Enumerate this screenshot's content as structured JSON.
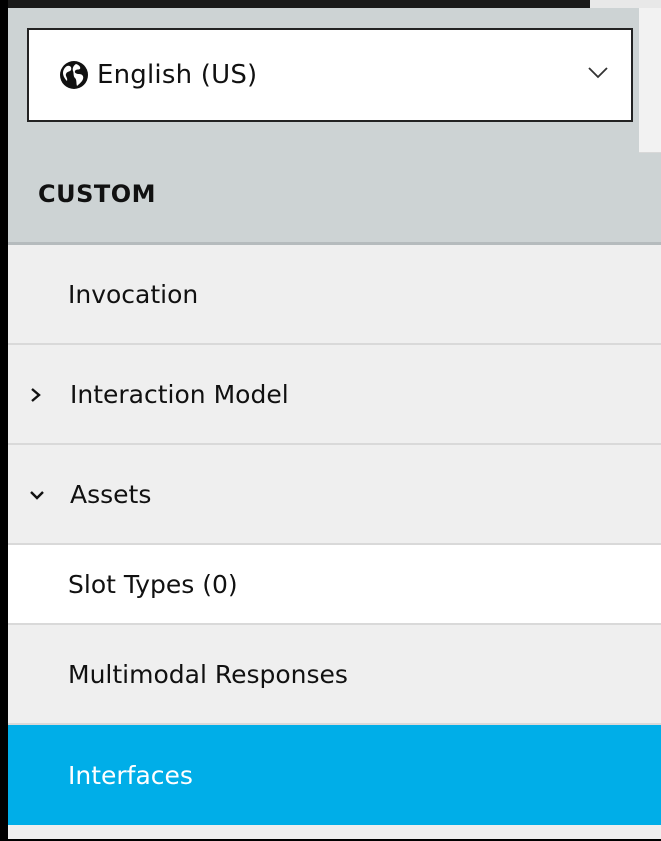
{
  "language_selector": {
    "selected": "English (US)",
    "icon": "globe-icon",
    "dropdown_icon": "chevron-down-icon"
  },
  "section": {
    "title": "CUSTOM"
  },
  "nav": {
    "items": [
      {
        "label": "Invocation"
      },
      {
        "label": "Interaction Model",
        "toggle": "chevron-right-icon"
      },
      {
        "label": "Assets",
        "toggle": "chevron-down-icon"
      },
      {
        "label": "Slot Types (0)"
      },
      {
        "label": "Multimodal Responses"
      },
      {
        "label": "Interfaces",
        "active": true
      }
    ]
  },
  "colors": {
    "header_bg": "#cdd3d4",
    "nav_bg": "#efefef",
    "active_bg": "#00aee8",
    "active_text": "#ffffff"
  }
}
